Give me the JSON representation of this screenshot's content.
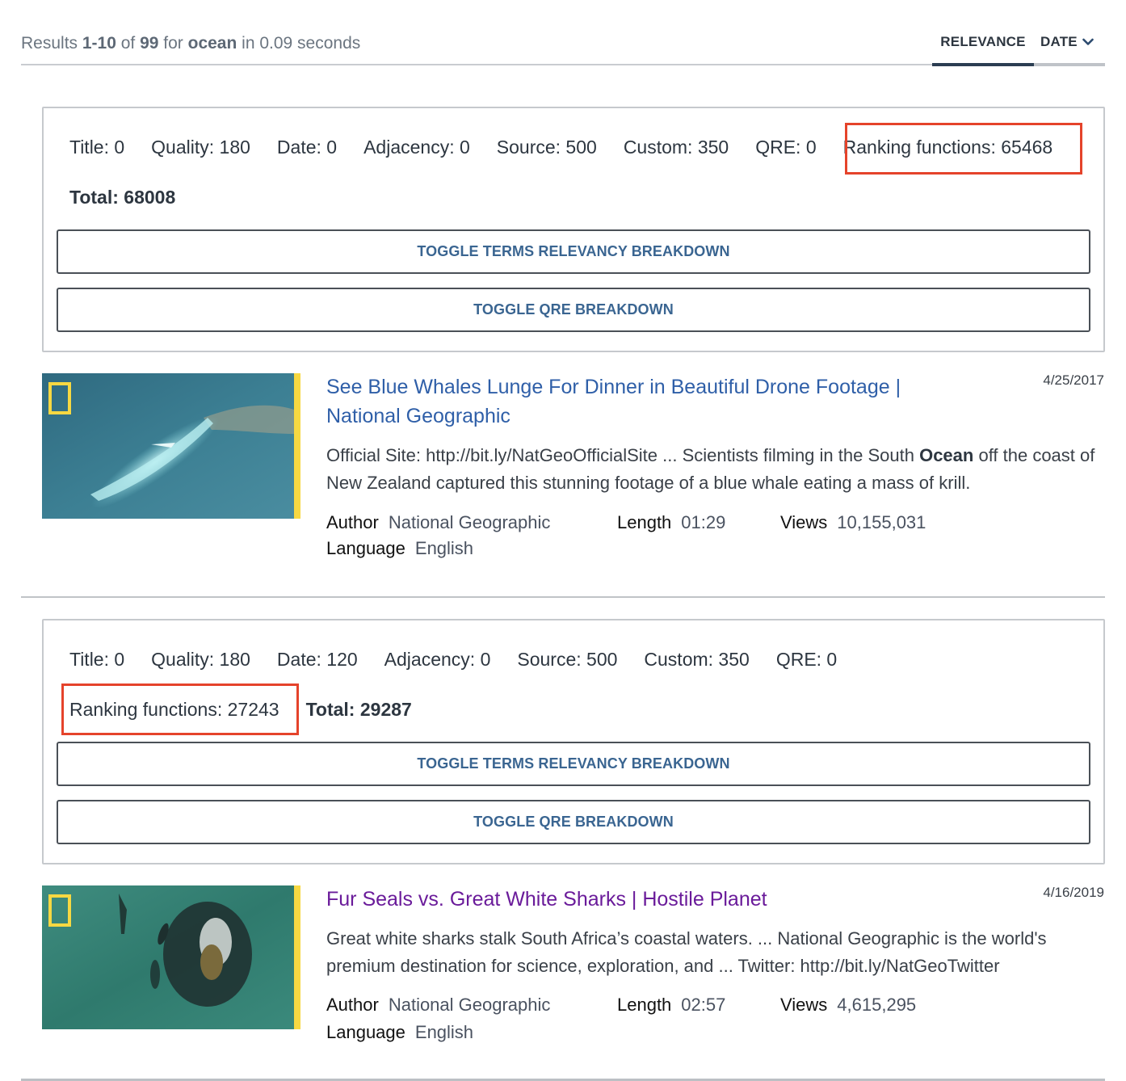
{
  "header": {
    "summary": {
      "prefix": "Results ",
      "range": "1-10",
      "of_text": " of ",
      "total": "99",
      "for_text": " for ",
      "query": "ocean",
      "suffix": " in 0.09 seconds"
    },
    "sort_tabs": [
      {
        "label": "RELEVANCE",
        "active": true
      },
      {
        "label": "DATE",
        "active": false,
        "icon": "chevron-down-icon"
      }
    ]
  },
  "results": [
    {
      "relevance": {
        "scores": [
          {
            "label": "Title: 0"
          },
          {
            "label": "Quality: 180"
          },
          {
            "label": "Date: 0"
          },
          {
            "label": "Adjacency: 0"
          },
          {
            "label": "Source: 500"
          },
          {
            "label": "Custom: 350"
          },
          {
            "label": "QRE: 0"
          }
        ],
        "ranking_functions": "Ranking functions: 65468",
        "total": "Total: 68008",
        "toggle_terms_label": "TOGGLE TERMS RELEVANCY BREAKDOWN",
        "toggle_qre_label": "TOGGLE QRE BREAKDOWN"
      },
      "title": "See Blue Whales Lunge For Dinner in Beautiful Drone Footage | National Geographic",
      "date": "4/25/2017",
      "description": {
        "before": "Official Site: http://bit.ly/NatGeoOfficialSite ... Scientists filming in the South ",
        "highlight": "Ocean",
        "after": " off the coast of New Zealand captured this stunning footage of a blue whale eating a mass of krill."
      },
      "meta": {
        "author_label": "Author",
        "author": "National Geographic",
        "length_label": "Length",
        "length": "01:29",
        "views_label": "Views",
        "views": "10,155,031",
        "language_label": "Language",
        "language": "English"
      },
      "link_color": "#2f5fa8",
      "thumbnail": "blue-whale-drone-thumbnail"
    },
    {
      "relevance": {
        "scores": [
          {
            "label": "Title: 0"
          },
          {
            "label": "Quality: 180"
          },
          {
            "label": "Date: 120"
          },
          {
            "label": "Adjacency: 0"
          },
          {
            "label": "Source: 500"
          },
          {
            "label": "Custom: 350"
          },
          {
            "label": "QRE: 0"
          }
        ],
        "ranking_functions": "Ranking functions: 27243",
        "total": "Total: 29287",
        "toggle_terms_label": "TOGGLE TERMS RELEVANCY BREAKDOWN",
        "toggle_qre_label": "TOGGLE QRE BREAKDOWN"
      },
      "title": "Fur Seals vs. Great White Sharks | Hostile Planet",
      "date": "4/16/2019",
      "description": {
        "before": "Great white sharks stalk South Africa’s coastal waters. ... National Geographic is the world's premium destination for science, exploration, and ... Twitter: http://bit.ly/NatGeoTwitter",
        "highlight": "",
        "after": ""
      },
      "meta": {
        "author_label": "Author",
        "author": "National Geographic",
        "length_label": "Length",
        "length": "02:57",
        "views_label": "Views",
        "views": "4,615,295",
        "language_label": "Language",
        "language": "English"
      },
      "link_color": "#6a1b9a",
      "thumbnail": "fur-seals-sharks-thumbnail"
    }
  ],
  "colors": {
    "highlight_box": "#e5432b",
    "toggle_text": "#3a6591",
    "tab_active_underline": "#2b3d52",
    "natgeo_yellow": "#f7d842"
  }
}
